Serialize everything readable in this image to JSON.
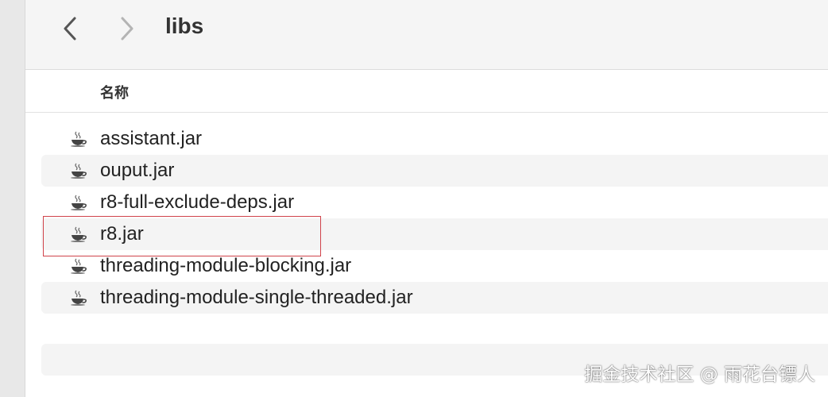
{
  "toolbar": {
    "back_icon": "chevron-left-icon",
    "forward_icon": "chevron-right-icon",
    "folder_title": "libs"
  },
  "header": {
    "column_name": "名称"
  },
  "files": [
    {
      "name": "assistant.jar",
      "icon": "java-jar-icon"
    },
    {
      "name": "ouput.jar",
      "icon": "java-jar-icon"
    },
    {
      "name": "r8-full-exclude-deps.jar",
      "icon": "java-jar-icon"
    },
    {
      "name": "r8.jar",
      "icon": "java-jar-icon"
    },
    {
      "name": "threading-module-blocking.jar",
      "icon": "java-jar-icon"
    },
    {
      "name": "threading-module-single-threaded.jar",
      "icon": "java-jar-icon"
    }
  ],
  "annotation": {
    "highlight_color": "#d0434b",
    "highlighted_file": "r8.jar"
  },
  "watermark": "掘金技术社区 @ 雨花台镖人"
}
